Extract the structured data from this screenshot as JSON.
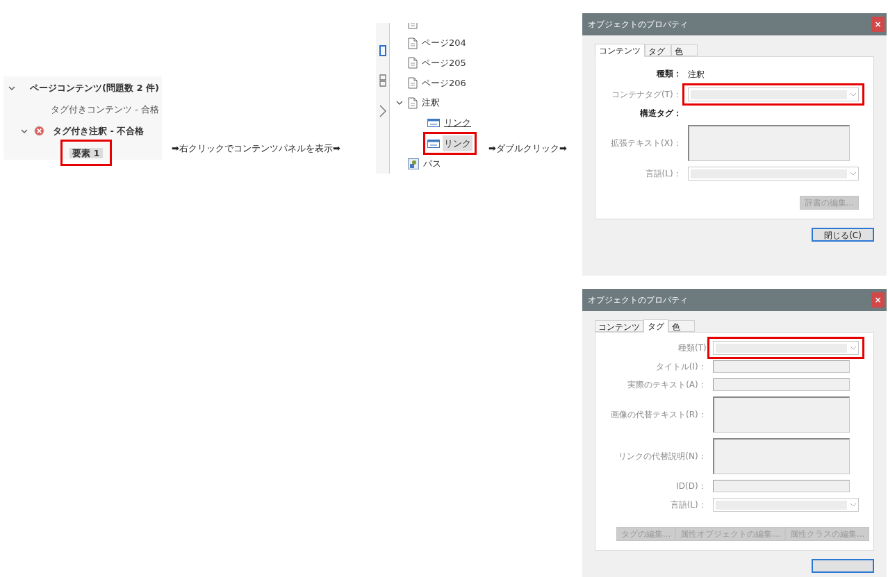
{
  "check_tree": [
    {
      "label": "ページコンテンツ(問題数 2 件)",
      "expanded": true,
      "children": [
        {
          "label": "タグ付きコンテンツ - 合格",
          "failed": false
        },
        {
          "label": "タグ付き注釈 - 不合格",
          "failed": true,
          "expanded": true,
          "children": [
            {
              "label": "要素 1",
              "selected": true,
              "highlighted": true
            }
          ]
        }
      ]
    }
  ],
  "step_1": "➡右クリックでコンテンツパネルを表示➡",
  "content_tree": [
    {
      "kind": "page",
      "label": "ページ204"
    },
    {
      "kind": "page",
      "label": "ページ205"
    },
    {
      "kind": "page",
      "label": "ページ206"
    },
    {
      "kind": "annotation",
      "label": "注釈",
      "expanded": true,
      "children": [
        {
          "kind": "link",
          "label": "リンク",
          "selected": false,
          "highlighted": false,
          "underlined": true
        },
        {
          "kind": "link",
          "label": "リンク",
          "selected": true,
          "highlighted": true,
          "underlined": false
        }
      ]
    },
    {
      "kind": "path",
      "label": "パス"
    }
  ],
  "step_2": "➡ダブルクリック➡",
  "dialogs": [
    {
      "title": "オブジェクトのプロパティ",
      "close": "×",
      "tabs": [
        {
          "label": "コンテンツ",
          "selected": true
        },
        {
          "label": "タグ",
          "selected": false
        },
        {
          "label": "色",
          "selected": false
        }
      ],
      "fields": [
        {
          "kind": "static",
          "label": "種類：",
          "value": "注釈"
        },
        {
          "kind": "combo",
          "label": "コンテナタグ(T)：",
          "highlighted": true
        },
        {
          "kind": "heading",
          "label": "構造タグ："
        },
        {
          "kind": "textarea",
          "label": "拡張テキスト(X)："
        },
        {
          "kind": "combo",
          "label": "言語(L)：",
          "highlighted": false
        }
      ],
      "buttons": [
        {
          "label": "辞書の編集...",
          "disabled": true
        }
      ],
      "close_button": {
        "label": "閉じる(C)",
        "default": true
      }
    },
    {
      "title": "オブジェクトのプロパティ",
      "close": "×",
      "tabs": [
        {
          "label": "コンテンツ",
          "selected": false
        },
        {
          "label": "タグ",
          "selected": true
        },
        {
          "label": "色",
          "selected": false
        }
      ],
      "fields": [
        {
          "kind": "combo",
          "label": "種類(T)",
          "highlighted": true
        },
        {
          "kind": "text",
          "label": "タイトル(I)："
        },
        {
          "kind": "text",
          "label": "実際のテキスト(A)："
        },
        {
          "kind": "textarea",
          "label": "画像の代替テキスト(R)："
        },
        {
          "kind": "textarea",
          "label": "リンクの代替説明(N)："
        },
        {
          "kind": "text",
          "label": "ID(D)："
        },
        {
          "kind": "combo",
          "label": "言語(L)：",
          "highlighted": false
        }
      ],
      "buttons": [
        {
          "label": "タグの編集...",
          "disabled": true
        },
        {
          "label": "属性オブジェクトの編集...",
          "disabled": true
        },
        {
          "label": "属性クラスの編集...",
          "disabled": true
        }
      ],
      "close_button": {
        "default": true
      }
    }
  ]
}
